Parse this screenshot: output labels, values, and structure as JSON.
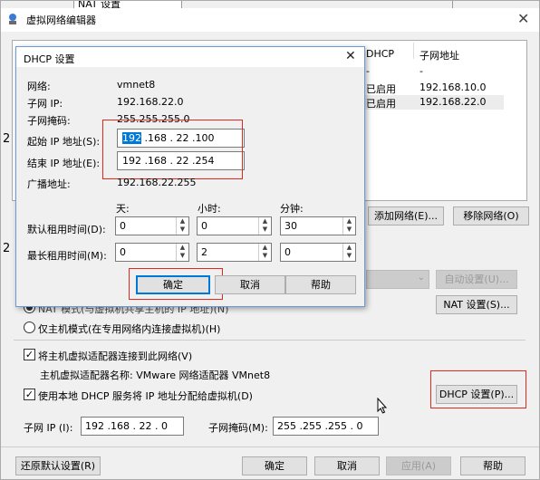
{
  "main": {
    "title": "虚拟网络编辑器",
    "tab_top": "NAT 设置",
    "table_headers": [
      "DHCP",
      "子网地址"
    ],
    "table_rows": [
      [
        "-",
        "-"
      ],
      [
        "已启用",
        "192.168.10.0"
      ],
      [
        "已启用",
        "192.168.22.0"
      ]
    ],
    "add_network": "添加网络(E)...",
    "remove_network": "移除网络(O)",
    "auto_settings": "自动设置(U)...",
    "nat_settings": "NAT 设置(S)...",
    "nat_mode_partial": "NAT 模式(与虚拟机共享主机的 IP 地址)(N)",
    "host_only_mode": "仅主机模式(在专用网络内连接虚拟机)(H)",
    "connect_host_adapter": "将主机虚拟适配器连接到此网络(V)",
    "host_adapter_name": "主机虚拟适配器名称: VMware 网络适配器 VMnet8",
    "use_dhcp": "使用本地 DHCP 服务将 IP 地址分配给虚拟机(D)",
    "dhcp_settings": "DHCP 设置(P)...",
    "subnet_ip_label": "子网 IP (I):",
    "subnet_ip": "192 .168 . 22 .  0",
    "subnet_mask_label": "子网掩码(M):",
    "subnet_mask": "255 .255 .255 .  0",
    "restore_defaults": "还原默认设置(R)",
    "ok": "确定",
    "cancel": "取消",
    "apply": "应用(A)",
    "help": "帮助",
    "side_digits": [
      "2",
      "2"
    ]
  },
  "dhcp": {
    "title": "DHCP 设置",
    "network_label": "网络:",
    "network": "vmnet8",
    "subnet_ip_label": "子网 IP:",
    "subnet_ip": "192.168.22.0",
    "subnet_mask_label": "子网掩码:",
    "subnet_mask": "255.255.255.0",
    "start_ip_label": "起始 IP 地址(S):",
    "start_ip_first": "192",
    "start_ip_rest": " .168 . 22 .100",
    "end_ip_label": "结束 IP 地址(E):",
    "end_ip": "192 .168 . 22 .254",
    "broadcast_label": "广播地址:",
    "broadcast": "192.168.22.255",
    "days": "天:",
    "hours": "小时:",
    "minutes": "分钟:",
    "default_lease": "默认租用时间(D):",
    "default_lease_values": [
      "0",
      "0",
      "30"
    ],
    "max_lease": "最长租用时间(M):",
    "max_lease_values": [
      "0",
      "2",
      "0"
    ],
    "ok": "确定",
    "cancel": "取消",
    "help": "帮助"
  }
}
